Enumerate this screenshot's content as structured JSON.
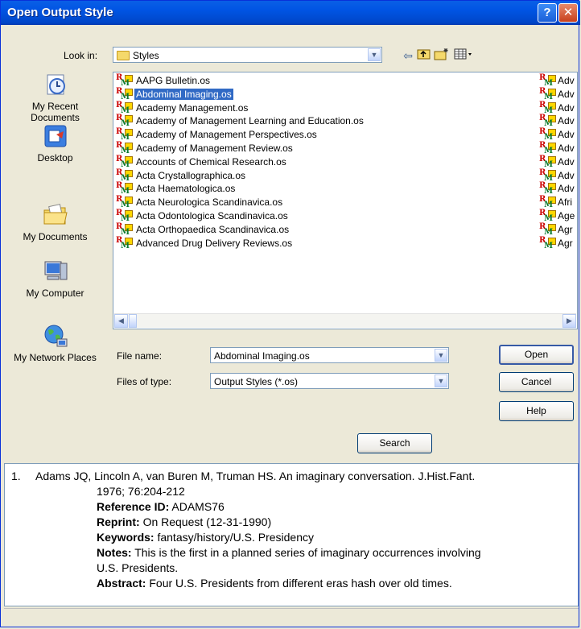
{
  "dialog": {
    "title": "Open Output Style",
    "help_button": "?",
    "close_button": "✕"
  },
  "look_in": {
    "label": "Look in:",
    "value": "Styles"
  },
  "places": [
    {
      "label": "My Recent Documents"
    },
    {
      "label": "Desktop"
    },
    {
      "label": "My Documents"
    },
    {
      "label": "My Computer"
    },
    {
      "label": "My Network Places"
    }
  ],
  "files": [
    {
      "name": "AAPG Bulletin.os"
    },
    {
      "name": "Abdominal Imaging.os"
    },
    {
      "name": "Academy Management.os"
    },
    {
      "name": "Academy of Management Learning and Education.os"
    },
    {
      "name": "Academy of Management Perspectives.os"
    },
    {
      "name": "Academy of Management Review.os"
    },
    {
      "name": "Accounts of Chemical Research.os"
    },
    {
      "name": "Acta Crystallographica.os"
    },
    {
      "name": "Acta Haematologica.os"
    },
    {
      "name": "Acta Neurologica Scandinavica.os"
    },
    {
      "name": "Acta Odontologica Scandinavica.os"
    },
    {
      "name": "Acta Orthopaedica Scandinavica.os"
    },
    {
      "name": "Advanced Drug Delivery Reviews.os"
    }
  ],
  "files_col2": [
    "Adv",
    "Adv",
    "Adv",
    "Adv",
    "Adv",
    "Adv",
    "Adv",
    "Adv",
    "Adv",
    "Afri",
    "Age",
    "Agr",
    "Agr"
  ],
  "selected_index": 1,
  "file_name": {
    "label": "File name:",
    "value": "Abdominal Imaging.os"
  },
  "file_type": {
    "label": "Files of type:",
    "value": "Output Styles (*.os)"
  },
  "buttons": {
    "open": "Open",
    "cancel": "Cancel",
    "help": "Help",
    "search": "Search"
  },
  "preview": {
    "number": "1.",
    "citation_line1": "Adams JQ, Lincoln A, van Buren M, Truman HS. An imaginary conversation. J.Hist.Fant.",
    "citation_line2": "1976; 76:204-212",
    "reference_id_label": "Reference ID:",
    "reference_id": "ADAMS76",
    "reprint_label": "Reprint:",
    "reprint": "On Request (12-31-1990)",
    "keywords_label": "Keywords:",
    "keywords": "fantasy/history/U.S. Presidency",
    "notes_label": "Notes:",
    "notes_line1": "This is the first in a planned series of imaginary occurrences involving",
    "notes_line2": "U.S. Presidents.",
    "abstract_label": "Abstract:",
    "abstract": "Four U.S. Presidents from different eras hash over old times."
  },
  "colors": {
    "title_bar": "#0054e3",
    "selection": "#316ac5",
    "dialog_bg": "#ece9d8"
  }
}
